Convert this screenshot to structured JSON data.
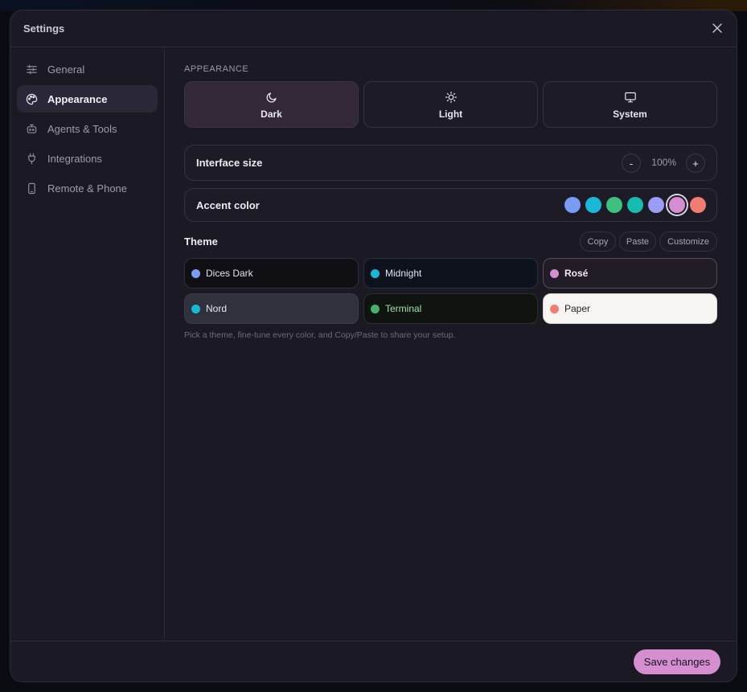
{
  "window": {
    "title": "Settings"
  },
  "sidebar": {
    "items": [
      {
        "label": "General",
        "icon": "sliders-icon",
        "active": false
      },
      {
        "label": "Appearance",
        "icon": "palette-icon",
        "active": true
      },
      {
        "label": "Agents & Tools",
        "icon": "robot-icon",
        "active": false
      },
      {
        "label": "Integrations",
        "icon": "plug-icon",
        "active": false
      },
      {
        "label": "Remote & Phone",
        "icon": "phone-icon",
        "active": false
      }
    ]
  },
  "appearance": {
    "section_label": "APPEARANCE",
    "modes": [
      {
        "label": "Dark",
        "icon": "moon-icon",
        "active": true
      },
      {
        "label": "Light",
        "icon": "sun-icon",
        "active": false
      },
      {
        "label": "System",
        "icon": "monitor-icon",
        "active": false
      }
    ],
    "interface_size": {
      "label": "Interface size",
      "value": "100%",
      "decrease": "-",
      "increase": "+"
    },
    "accent": {
      "label": "Accent color",
      "colors": [
        "#7b9cf5",
        "#18b9d6",
        "#3ec07f",
        "#14bdb0",
        "#9b9cf6",
        "#d58ed0",
        "#f07c72"
      ],
      "selected_index": 5
    }
  },
  "theme": {
    "heading": "Theme",
    "actions": {
      "copy": "Copy",
      "paste": "Paste",
      "customize": "Customize"
    },
    "options": [
      {
        "name": "Dices Dark",
        "dot": "#7b9cf5",
        "bg": "#0f0f14",
        "text": "#e4e2ec",
        "border": "#2f2e3a",
        "selected": false
      },
      {
        "name": "Midnight",
        "dot": "#18b9d6",
        "bg": "#0e121c",
        "text": "#dfe6f2",
        "border": "#2a2f3c",
        "selected": false
      },
      {
        "name": "Rosé",
        "dot": "#d58ed0",
        "bg": "#221c26",
        "text": "#f3e8f1",
        "border": "#5a4a5c",
        "selected": true
      },
      {
        "name": "Nord",
        "dot": "#18b9d6",
        "bg": "#2f323c",
        "text": "#e6e8ee",
        "border": "#3b3e48",
        "selected": false
      },
      {
        "name": "Terminal",
        "dot": "#45b26b",
        "bg": "#0f1410",
        "text": "#9fe3a8",
        "border": "#2a3029",
        "selected": false
      },
      {
        "name": "Paper",
        "dot": "#f07c72",
        "bg": "#f7f4f2",
        "text": "#2a2428",
        "border": "#dcd6d4",
        "selected": false
      }
    ],
    "hint": "Pick a theme, fine-tune every color, and Copy/Paste to share your setup."
  },
  "footer": {
    "save_label": "Save changes"
  }
}
